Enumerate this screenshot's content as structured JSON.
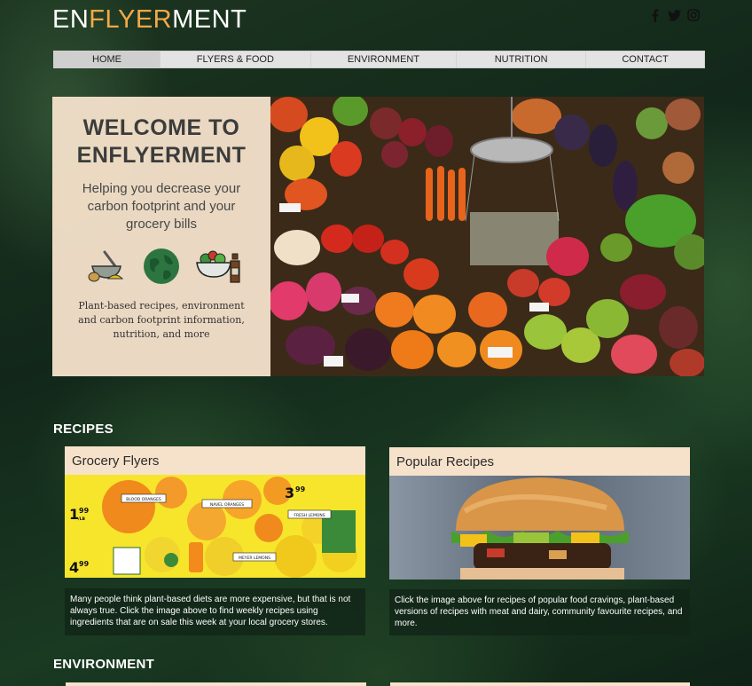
{
  "site": {
    "logo_part1": "EN",
    "logo_part2": "FLYER",
    "logo_part3": "MENT",
    "accent_color": "#f3a947",
    "social": [
      "facebook-icon",
      "twitter-icon",
      "instagram-icon"
    ]
  },
  "nav": {
    "items": [
      {
        "label": "HOME",
        "active": true
      },
      {
        "label": "FLYERS & FOOD",
        "active": false
      },
      {
        "label": "ENVIRONMENT",
        "active": false
      },
      {
        "label": "NUTRITION",
        "active": false
      },
      {
        "label": "CONTACT",
        "active": false
      }
    ]
  },
  "hero": {
    "title_line1": "WELCOME TO",
    "title_line2": "ENFLYERMENT",
    "subtitle": "Helping you decrease your carbon footprint and your grocery bills",
    "description": "Plant-based recipes, environment and carbon footprint information, nutrition, and more",
    "icons": [
      "mortar-pestle-icon",
      "globe-icon",
      "salad-bowl-icon"
    ]
  },
  "recipes": {
    "heading": "RECIPES",
    "cards": [
      {
        "title": "Grocery Flyers",
        "description": "Many people think plant-based diets are more expensive, but that is not always true. Click the image above to find weekly recipes using ingredients that are on sale this week at your local grocery stores.",
        "flyer": {
          "price1": "1",
          "price1_cents": "99",
          "price1_unit": "/LB",
          "price2": "4",
          "price2_cents": "99",
          "price3": "3",
          "price3_cents": "99",
          "label_blood": "BLOOD ORANGES",
          "label_navel": "NAVEL ORANGES",
          "label_fresh": "FRESH LEMONS",
          "label_meyer": "MEYER LEMONS"
        }
      },
      {
        "title": "Popular Recipes",
        "description": "Click the image above for recipes of popular food cravings, plant-based versions of recipes with meat and dairy, community favourite recipes, and more."
      }
    ]
  },
  "environment": {
    "heading": "ENVIRONMENT"
  }
}
